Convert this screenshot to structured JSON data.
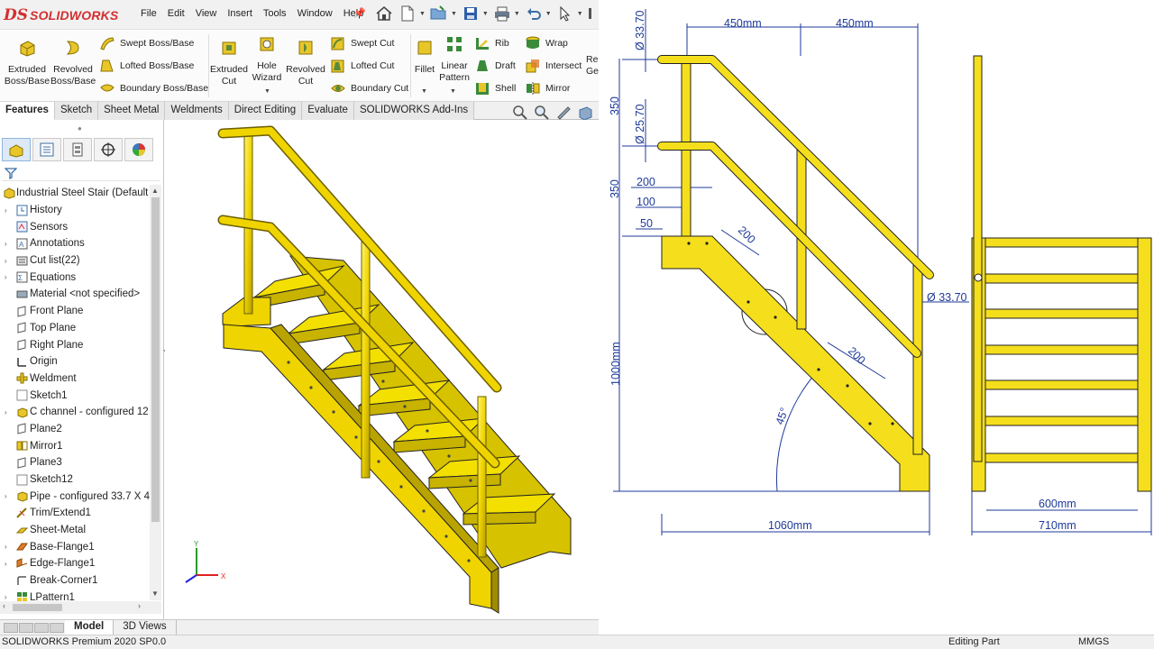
{
  "app": {
    "logo_prefix": "DS",
    "logo_text": "SOLIDWORKS",
    "menus": [
      "File",
      "Edit",
      "View",
      "Insert",
      "Tools",
      "Window",
      "Help"
    ]
  },
  "ribbon": {
    "extruded_boss": "Extruded Boss/Base",
    "revolved_boss": "Revolved Boss/Base",
    "swept_boss": "Swept Boss/Base",
    "lofted_boss": "Lofted Boss/Base",
    "boundary_boss": "Boundary Boss/Base",
    "extruded_cut": "Extruded Cut",
    "hole_wizard": "Hole Wizard",
    "revolved_cut": "Revolved Cut",
    "swept_cut": "Swept Cut",
    "lofted_cut": "Lofted Cut",
    "boundary_cut": "Boundary Cut",
    "fillet": "Fillet",
    "linear_pattern": "Linear Pattern",
    "rib": "Rib",
    "draft": "Draft",
    "shell": "Shell",
    "wrap": "Wrap",
    "intersect": "Intersect",
    "mirror": "Mirror",
    "ref_geometry_partial": "Re Ge"
  },
  "tabs": [
    "Features",
    "Sketch",
    "Sheet Metal",
    "Weldments",
    "Direct Editing",
    "Evaluate",
    "SOLIDWORKS Add-Ins"
  ],
  "tree": {
    "root": "Industrial Steel Stair  (Default",
    "items": [
      {
        "label": "History",
        "icon": "history-icon",
        "expand": true
      },
      {
        "label": "Sensors",
        "icon": "sensors-icon",
        "expand": false
      },
      {
        "label": "Annotations",
        "icon": "annotations-icon",
        "expand": true
      },
      {
        "label": "Cut list(22)",
        "icon": "cutlist-icon",
        "expand": true
      },
      {
        "label": "Equations",
        "icon": "equations-icon",
        "expand": true
      },
      {
        "label": "Material <not specified>",
        "icon": "material-icon",
        "expand": false
      },
      {
        "label": "Front Plane",
        "icon": "plane-icon",
        "expand": false
      },
      {
        "label": "Top Plane",
        "icon": "plane-icon",
        "expand": false
      },
      {
        "label": "Right Plane",
        "icon": "plane-icon",
        "expand": false
      },
      {
        "label": "Origin",
        "icon": "origin-icon",
        "expand": false
      },
      {
        "label": "Weldment",
        "icon": "weldment-icon",
        "expand": false
      },
      {
        "label": "Sketch1",
        "icon": "sketch-icon",
        "expand": false
      },
      {
        "label": "C channel - configured 12",
        "icon": "structural-member-icon",
        "expand": true
      },
      {
        "label": "Plane2",
        "icon": "plane-icon",
        "expand": false
      },
      {
        "label": "Mirror1",
        "icon": "mirror-icon",
        "expand": false
      },
      {
        "label": "Plane3",
        "icon": "plane-icon",
        "expand": false
      },
      {
        "label": "Sketch12",
        "icon": "sketch-icon",
        "expand": false
      },
      {
        "label": "Pipe - configured 33.7 X 4",
        "icon": "structural-member-icon",
        "expand": true
      },
      {
        "label": "Trim/Extend1",
        "icon": "trim-extend-icon",
        "expand": false
      },
      {
        "label": "Sheet-Metal",
        "icon": "sheet-metal-icon",
        "expand": false
      },
      {
        "label": "Base-Flange1",
        "icon": "base-flange-icon",
        "expand": true
      },
      {
        "label": "Edge-Flange1",
        "icon": "edge-flange-icon",
        "expand": true
      },
      {
        "label": "Break-Corner1",
        "icon": "break-corner-icon",
        "expand": false
      },
      {
        "label": "LPattern1",
        "icon": "linear-pattern-icon",
        "expand": true
      }
    ]
  },
  "bottom_tabs": [
    "Model",
    "3D Views"
  ],
  "status": {
    "version": "SOLIDWORKS Premium 2020 SP0.0",
    "mode": "Editing Part",
    "units": "MMGS"
  },
  "triad": {
    "y": "Y",
    "x": "X"
  },
  "drawing": {
    "dims": {
      "top_left": "450mm",
      "top_right": "450mm",
      "rail_dia_top": "Ø 33.70",
      "rail_dia_mid": "Ø 25.70",
      "upper_gap": "350",
      "lower_gap": "350",
      "d200": "200",
      "d100": "100",
      "d50": "50",
      "step_spacing_top": "200",
      "step_spacing_mid": "200",
      "post_dia": "Ø 33.70",
      "height": "1000mm",
      "angle": "45°",
      "length": "1060mm",
      "inner_width": "600mm",
      "outer_width": "710mm"
    }
  },
  "colors": {
    "steel_yellow": "#f2e000",
    "dimension_blue": "#1f3a9a",
    "logo_red": "#d32f2f"
  }
}
